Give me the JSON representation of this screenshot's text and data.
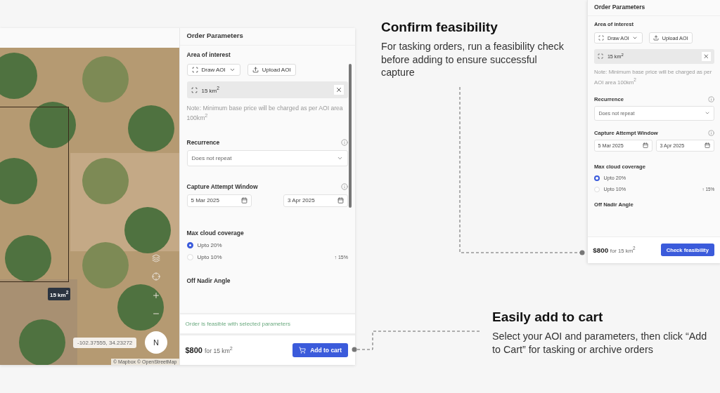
{
  "map": {
    "area_label": "15 km$^{2}$",
    "coordinates": "-102.37555, 34.23272",
    "compass": "N",
    "attribution": "© Mapbox © OpenStreetMap"
  },
  "panels": [
    {
      "title": "Order Parameters",
      "scrollable": true,
      "aoi_label": "Area of interest",
      "draw_button": "Draw AOI",
      "upload_button": "Upload AOI",
      "aoi_value": "15 km$^{2}$",
      "note": "Note: Minimum base price will be charged as per AOI area 100km$^{2}$",
      "recurrence": {
        "label": "Recurrence",
        "value": "Does not repeat"
      },
      "capture_window": {
        "label": "Capture Attempt Window",
        "start": "5 Mar 2025",
        "end": "3 Apr 2025"
      },
      "cloud": {
        "label": "Max cloud coverage",
        "options": [
          {
            "label": "Upto 20%",
            "selected": true
          },
          {
            "label": "Upto 10%",
            "selected": false,
            "delta": "↑ 15%"
          }
        ]
      },
      "off_nadir_label": "Off Nadir Angle",
      "status": "Order is feasible with selected parameters",
      "price": "$800",
      "price_unit": "for 15 km$^{2}$",
      "action": {
        "label": "Add to cart",
        "kind": "cart"
      }
    },
    {
      "title": "Order Parameters",
      "scrollable": false,
      "aoi_label": "Area of interest",
      "draw_button": "Draw AOI",
      "upload_button": "Upload AOI",
      "aoi_value": "15 km$^{2}$",
      "note": "Note: Minimum base price will be charged as per AOI area 100km$^{2}$",
      "recurrence": {
        "label": "Recurrence",
        "value": "Does not repeat"
      },
      "capture_window": {
        "label": "Capture Attempt Window",
        "start": "5 Mar 2025",
        "end": "3 Apr 2025"
      },
      "cloud": {
        "label": "Max cloud coverage",
        "options": [
          {
            "label": "Upto 20%",
            "selected": true
          },
          {
            "label": "Upto 10%",
            "selected": false,
            "delta": "↑ 15%"
          }
        ]
      },
      "off_nadir_label": "Off Nadir Angle",
      "price": "$800",
      "price_unit": "for 15 km$^{2}$",
      "action": {
        "label": "Check feasibility",
        "kind": "plain"
      }
    }
  ],
  "callouts": [
    {
      "title": "Confirm feasibility",
      "text": "For tasking orders, run a feasibility check before adding to ensure successful capture"
    },
    {
      "title": "Easily add to cart",
      "text": "Select your AOI and parameters, then click “Add to Cart” for tasking or archive orders"
    }
  ]
}
